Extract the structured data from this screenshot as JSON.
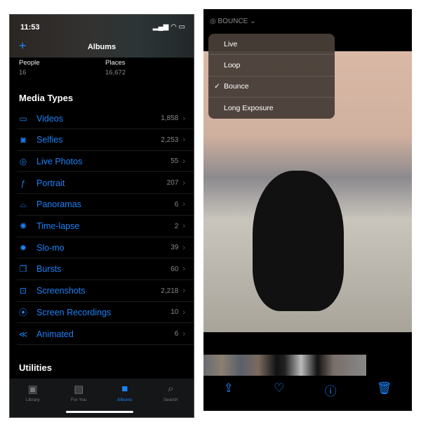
{
  "left": {
    "status": {
      "time": "11:53",
      "icons": "signal wifi battery"
    },
    "header": {
      "add": "+",
      "title": "Albums"
    },
    "people": {
      "label": "People",
      "count": "16"
    },
    "places": {
      "label": "Places",
      "count": "16,672"
    },
    "media_types_title": "Media Types",
    "media_types": [
      {
        "icon": "video-icon",
        "glyph": "▭",
        "label": "Videos",
        "count": "1,858"
      },
      {
        "icon": "selfie-icon",
        "glyph": "◙",
        "label": "Selfies",
        "count": "2,253"
      },
      {
        "icon": "live-photo-icon",
        "glyph": "◎",
        "label": "Live Photos",
        "count": "55"
      },
      {
        "icon": "portrait-icon",
        "glyph": "ƒ",
        "label": "Portrait",
        "count": "207"
      },
      {
        "icon": "panorama-icon",
        "glyph": "⌓",
        "label": "Panoramas",
        "count": "6"
      },
      {
        "icon": "timelapse-icon",
        "glyph": "✺",
        "label": "Time-lapse",
        "count": "2"
      },
      {
        "icon": "slomo-icon",
        "glyph": "✹",
        "label": "Slo-mo",
        "count": "39"
      },
      {
        "icon": "bursts-icon",
        "glyph": "❐",
        "label": "Bursts",
        "count": "60"
      },
      {
        "icon": "screenshot-icon",
        "glyph": "⊡",
        "label": "Screenshots",
        "count": "2,218"
      },
      {
        "icon": "screen-recording-icon",
        "glyph": "⦿",
        "label": "Screen Recordings",
        "count": "10"
      },
      {
        "icon": "animated-icon",
        "glyph": "≪",
        "label": "Animated",
        "count": "6"
      }
    ],
    "utilities_title": "Utilities",
    "tabs": [
      {
        "label": "Library",
        "glyph": "▣"
      },
      {
        "label": "For You",
        "glyph": "▤"
      },
      {
        "label": "Albums",
        "glyph": "■",
        "active": true
      },
      {
        "label": "Search",
        "glyph": "⌕"
      }
    ]
  },
  "right": {
    "mode": "BOUNCE",
    "menu": [
      {
        "label": "Live"
      },
      {
        "label": "Loop"
      },
      {
        "label": "Bounce",
        "checked": true
      },
      {
        "label": "Long Exposure"
      }
    ],
    "check": "✓",
    "toolbar": [
      "share-icon",
      "heart-icon",
      "info-icon",
      "trash-icon"
    ]
  },
  "colors": {
    "accent": "#1a82f7",
    "background": "#000000",
    "menu": "#483e38"
  }
}
